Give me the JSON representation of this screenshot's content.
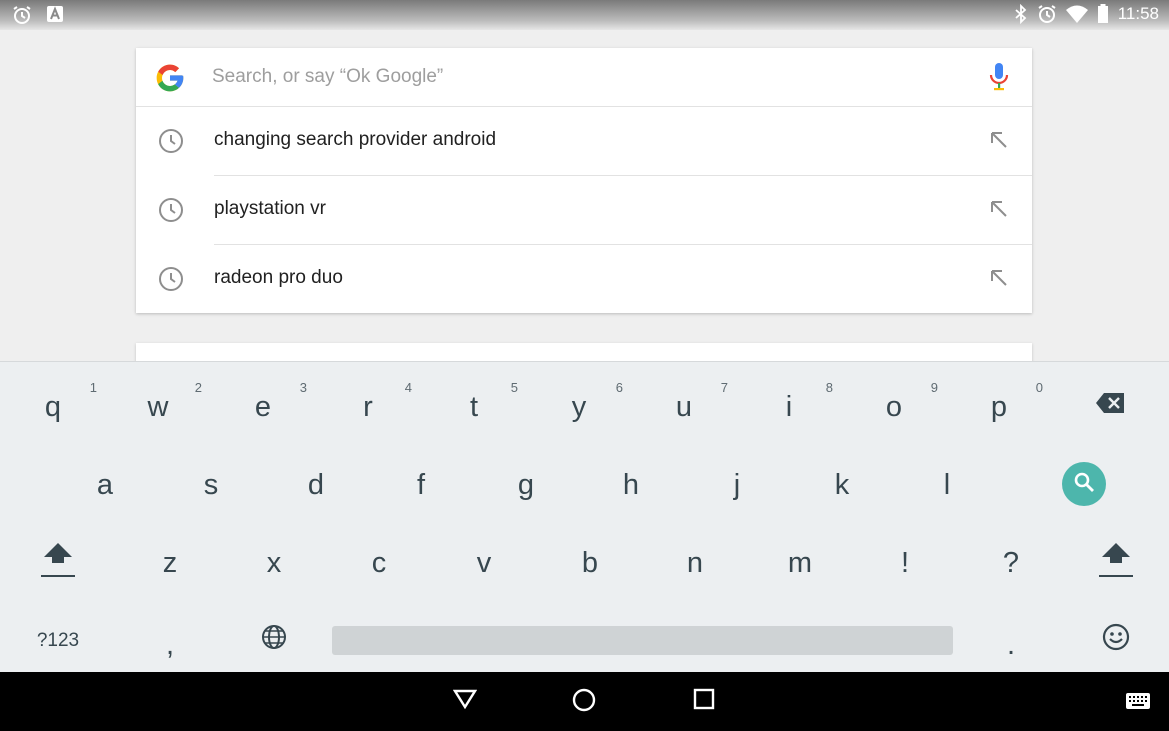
{
  "status_bar": {
    "time": "11:58",
    "left_icons": [
      "alarm-icon",
      "notification-a-icon"
    ],
    "right_icons": [
      "bluetooth-icon",
      "alarm-icon",
      "wifi-icon",
      "battery-icon"
    ]
  },
  "search": {
    "placeholder": "Search, or say “Ok Google”",
    "value": "",
    "logo": "google-g-icon",
    "voice_icon": "microphone-icon"
  },
  "suggestions": [
    {
      "text": "changing search provider android",
      "type": "history"
    },
    {
      "text": "playstation vr",
      "type": "history"
    },
    {
      "text": "radeon pro duo",
      "type": "history"
    }
  ],
  "keyboard": {
    "row1": [
      {
        "key": "q",
        "hint": "1"
      },
      {
        "key": "w",
        "hint": "2"
      },
      {
        "key": "e",
        "hint": "3"
      },
      {
        "key": "r",
        "hint": "4"
      },
      {
        "key": "t",
        "hint": "5"
      },
      {
        "key": "y",
        "hint": "6"
      },
      {
        "key": "u",
        "hint": "7"
      },
      {
        "key": "i",
        "hint": "8"
      },
      {
        "key": "o",
        "hint": "9"
      },
      {
        "key": "p",
        "hint": "0"
      }
    ],
    "row2": [
      "a",
      "s",
      "d",
      "f",
      "g",
      "h",
      "j",
      "k",
      "l"
    ],
    "row3": [
      "z",
      "x",
      "c",
      "v",
      "b",
      "n",
      "m",
      "!",
      "?"
    ],
    "row4": {
      "symbols": "?123",
      "comma": ",",
      "period": "."
    },
    "action_key": "search-icon"
  },
  "colors": {
    "accent": "#4db6ac",
    "google_blue": "#4285f4",
    "google_red": "#ea4335",
    "google_yellow": "#fbbc05",
    "google_green": "#34a853",
    "keyboard_bg": "#eceff1"
  }
}
